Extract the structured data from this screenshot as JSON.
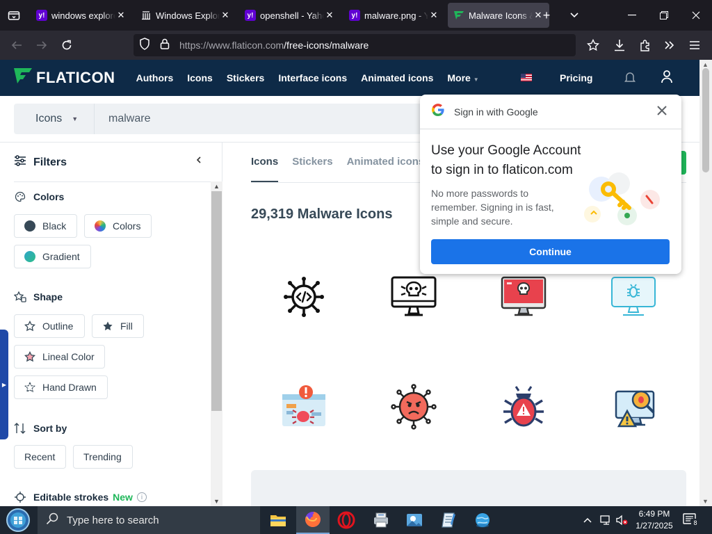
{
  "browser": {
    "tabs": [
      {
        "title": "windows explorer",
        "favicon": "yahoo-icon",
        "active": false
      },
      {
        "title": "Windows Explorer",
        "favicon": "document-icon",
        "active": false
      },
      {
        "title": "openshell - Yahoo",
        "favicon": "yahoo-icon",
        "active": false
      },
      {
        "title": "malware.png - Yahoo",
        "favicon": "yahoo-icon",
        "active": false
      },
      {
        "title": "Malware Icons & Symbols",
        "favicon": "flaticon-icon",
        "active": true
      }
    ],
    "new_tab": "+",
    "url_host": "https://www.flaticon.com",
    "url_path": "/free-icons/malware",
    "close_glyph": "✕"
  },
  "site": {
    "logo_text": "FLATICON",
    "nav": [
      "Authors",
      "Icons",
      "Stickers",
      "Interface icons",
      "Animated icons"
    ],
    "more": "More",
    "pricing": "Pricing",
    "brand_color": "#0e2a47",
    "accent_green": "#1fb75a"
  },
  "search": {
    "type": "Icons",
    "query": "malware"
  },
  "sidebar": {
    "title": "Filters",
    "colors_title": "Colors",
    "color_chips": [
      {
        "label": "Black",
        "swatch": "#374957"
      },
      {
        "label": "Colors",
        "swatch": "conic"
      },
      {
        "label": "Gradient",
        "swatch": "gradient"
      }
    ],
    "shape_title": "Shape",
    "shape_chips": [
      "Outline",
      "Fill",
      "Lineal Color",
      "Hand Drawn"
    ],
    "sort_title": "Sort by",
    "sort_chips": [
      "Recent",
      "Trending"
    ],
    "strokes_title": "Editable strokes",
    "strokes_badge": "New",
    "info_glyph": "i"
  },
  "content": {
    "tabs": [
      "Icons",
      "Stickers",
      "Animated icons"
    ],
    "result_title": "29,319 Malware Icons",
    "icons": [
      "virus-code-icon",
      "skull-monitor-icon",
      "red-skull-monitor-icon",
      "bug-monitor-icon",
      "browser-bug-alert-icon",
      "angry-virus-icon",
      "bug-warning-icon",
      "computer-warning-icon"
    ]
  },
  "google_popup": {
    "header": "Sign in with Google",
    "title_line1": "Use your Google Account",
    "title_line2": "to sign in to flaticon.com",
    "body": "No more passwords to remember. Signing in is fast, simple and secure.",
    "button": "Continue",
    "button_color": "#1a73e8"
  },
  "taskbar": {
    "search_placeholder": "Type here to search",
    "time": "6:49 PM",
    "date": "1/27/2025",
    "notification_count": "8"
  }
}
